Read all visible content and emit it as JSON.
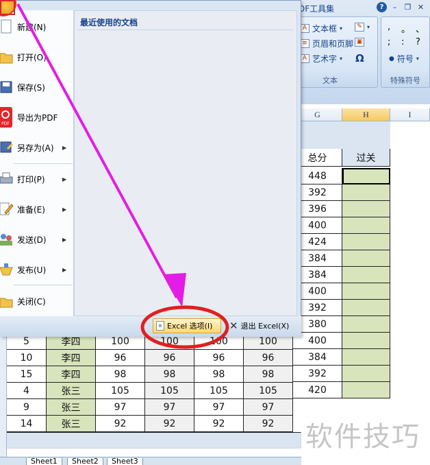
{
  "ribbon": {
    "title_fragment": "DF工具集",
    "text_group": {
      "label": "文本",
      "items": [
        "文本框",
        "页眉和页脚",
        "艺术字"
      ],
      "symbol_glyph": "Ω"
    },
    "symbols_group": {
      "label": "特殊符号",
      "symbol_button": "符号",
      "glyphs": [
        ",",
        "。",
        "、",
        ";",
        ":",
        "?"
      ]
    }
  },
  "office_menu": {
    "recent_docs_title": "最近使用的文档",
    "items": [
      {
        "label": "新建(N)",
        "icon": "new-document-icon",
        "submenu": false
      },
      {
        "label": "打开(O)",
        "icon": "open-folder-icon",
        "submenu": false
      },
      {
        "label": "保存(S)",
        "icon": "save-disk-icon",
        "submenu": false
      },
      {
        "label": "导出为PDF",
        "icon": "pdf-export-icon",
        "submenu": false,
        "badge": "PDF"
      },
      {
        "label": "另存为(A)",
        "icon": "save-as-icon",
        "submenu": true
      },
      {
        "label": "打印(P)",
        "icon": "printer-icon",
        "submenu": true
      },
      {
        "label": "准备(E)",
        "icon": "prepare-pencil-icon",
        "submenu": true
      },
      {
        "label": "发送(D)",
        "icon": "send-people-icon",
        "submenu": true
      },
      {
        "label": "发布(U)",
        "icon": "publish-icon",
        "submenu": true
      },
      {
        "label": "关闭(C)",
        "icon": "close-folder-icon",
        "submenu": false
      }
    ],
    "excel_options_label": "Excel 选项(I)",
    "exit_label": "退出 Excel(X)"
  },
  "sheet": {
    "columns": [
      "G",
      "H",
      "I"
    ],
    "active_column": "H",
    "header_total": "总分",
    "header_pass": "过关",
    "total_column_values": [
      "448",
      "392",
      "396",
      "400",
      "424",
      "384",
      "384",
      "400",
      "392",
      "380",
      "400",
      "384",
      "392",
      "420"
    ],
    "visible_rows": [
      {
        "a": "5",
        "b": "李四",
        "c": "100",
        "d": "100",
        "e": "100",
        "f": "100",
        "g": "400"
      },
      {
        "a": "10",
        "b": "李四",
        "c": "96",
        "d": "96",
        "e": "96",
        "f": "96",
        "g": "384"
      },
      {
        "a": "15",
        "b": "李四",
        "c": "98",
        "d": "98",
        "e": "98",
        "f": "98",
        "g": "392"
      },
      {
        "a": "4",
        "b": "张三",
        "c": "105",
        "d": "105",
        "e": "105",
        "f": "105",
        "g": "420"
      },
      {
        "a": "9",
        "b": "张三",
        "c": "97",
        "d": "97",
        "e": "97",
        "f": "97",
        "g": ""
      },
      {
        "a": "14",
        "b": "张三",
        "c": "92",
        "d": "92",
        "e": "92",
        "f": "92",
        "g": ""
      }
    ],
    "tabs": [
      "Sheet1",
      "Sheet2",
      "Sheet3"
    ]
  },
  "colors": {
    "highlight_green": "#d8e4bc",
    "arrow_magenta": "#e31de6",
    "circle_red": "#e0201e"
  },
  "watermark": "软件技巧"
}
